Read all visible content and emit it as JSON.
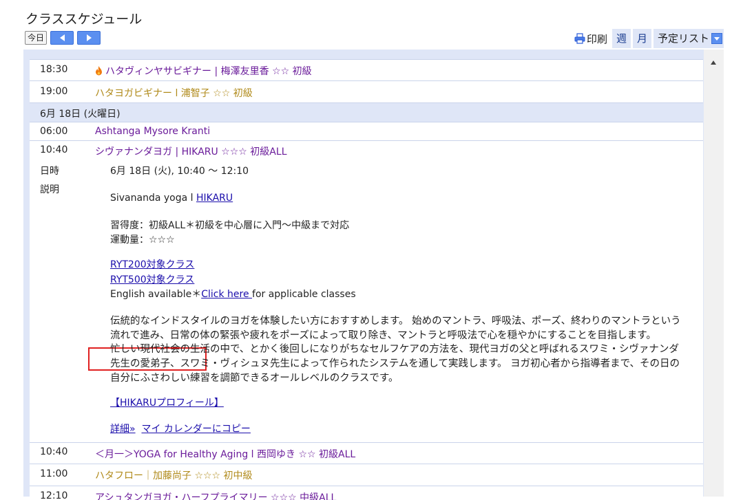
{
  "page_title": "クラススケジュール",
  "toolbar": {
    "today_label": "今日",
    "print_label": "印刷",
    "week_label": "週",
    "month_label": "月",
    "agenda_label": "予定リスト"
  },
  "events_top": [
    {
      "time": "18:30",
      "title": "ハタヴィンヤサビギナー | 梅澤友里香 ☆☆ 初級",
      "color": "#6a1b9a",
      "icon": "fire-icon"
    },
    {
      "time": "19:00",
      "title": "ハタヨガビギナー l 浦智子 ☆☆ 初級",
      "color": "#b08a1a"
    }
  ],
  "date_header": "6月 18日 (火曜日)",
  "event_mysore": {
    "time": "06:00",
    "title": "Ashtanga Mysore Kranti"
  },
  "event_open": {
    "time": "10:40",
    "title": "シヴァナンダヨガ | HIKARU ☆☆☆ 初級ALL",
    "label_datetime": "日時",
    "label_description": "説明",
    "datetime": "6月 18日 (火), 10:40 ～ 12:10",
    "desc_line1_prefix": "Sivananda yoga l ",
    "desc_line1_link": "HIKARU",
    "level_line": "習得度：初級ALL＊初級を中心層に入門～中級まで対応",
    "exercise_line": "運動量：☆☆☆",
    "ryt200_link": "RYT200対象クラス",
    "ryt500_link": "RYT500対象クラス",
    "english_prefix": "English available＊",
    "english_link": "Click here ",
    "english_suffix": "for applicable classes",
    "para1_line1": "伝統的なインドスタイルのヨガを体験したい方におすすめします。 始めのマントラ、呼吸法、ポーズ、終わりのマントラという",
    "para1_line2": "流れで進み、日常の体の緊張や疲れをポーズによって取り除き、マントラと呼吸法で心を穏やかにすることを目指します。",
    "para2_line1": "忙しい現代社会の生活の中で、とかく後回しになりがちなセルフケアの方法を、現代ヨガの父と呼ばれるスワミ・シヴァナンダ",
    "para2_line2": "先生の愛弟子、スワミ・ヴィシュヌ先生によって作られたシステムを通して実践します。 ヨガ初心者から指導者まで、その日の",
    "para2_line3": "自分にふさわしい練習を調節できるオールレベルのクラスです。",
    "profile_link": "【HIKARUプロフィール】",
    "details_link": "詳細»",
    "copy_link": "マイ カレンダーにコピー"
  },
  "events_bottom": [
    {
      "time": "10:40",
      "title": "＜月一＞YOGA for Healthy Aging l 西岡ゆき ☆☆ 初級ALL",
      "color": "#6a1b9a"
    },
    {
      "time": "11:00",
      "title": "ハタフロー｜加藤尚子 ☆☆☆ 初中級",
      "color": "#b08a1a"
    },
    {
      "time": "12:10",
      "title": "アシュタンガヨガ・ハーフプライマリー ☆☆☆ 中級ALL",
      "color": "#6a1b9a"
    }
  ],
  "colors": {
    "accent": "#5b8ff0",
    "header_bg": "#dfe6f7",
    "highlight_box": "#e02020"
  }
}
